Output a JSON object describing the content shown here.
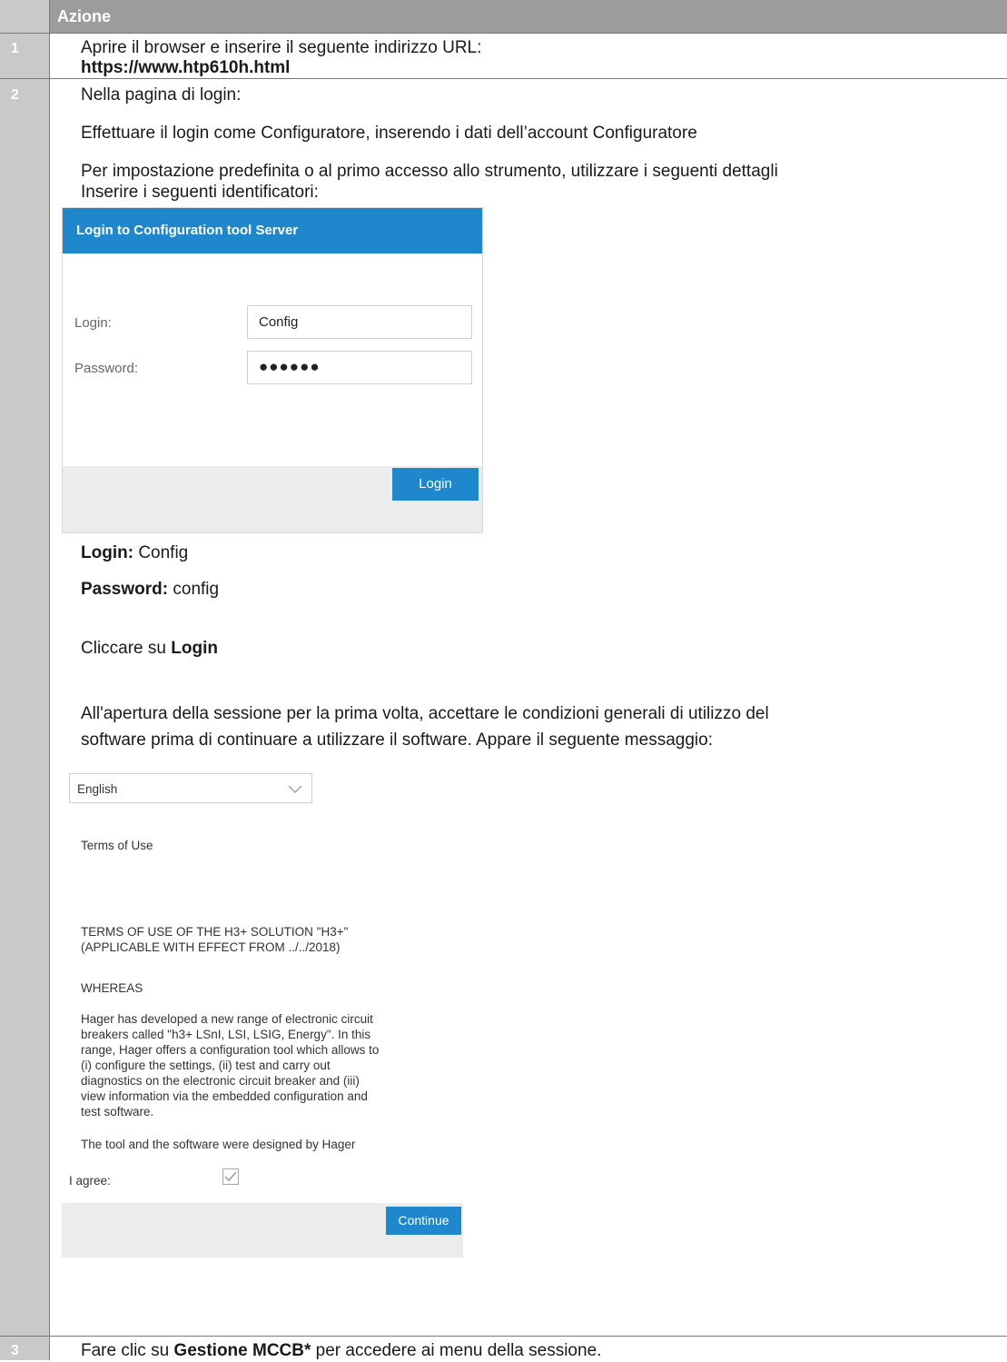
{
  "header": {
    "title": "Azione"
  },
  "steps": [
    {
      "num": "1",
      "line1": "Aprire il browser e inserire il seguente indirizzo URL:",
      "url": "https://www.htp610h.html"
    },
    {
      "num": "2",
      "intro": "Nella pagina di login:",
      "p1": "Effettuare il login come Configuratore, inserendo i dati dell’account Configuratore",
      "p2": "Per impostazione predefinita o al primo accesso allo strumento, utilizzare i seguenti dettagli",
      "p3": "Inserire i seguenti identificatori:",
      "login_label": "Login:",
      "login_value": "Config",
      "password_label": "Password:",
      "password_value": "config",
      "click_prefix": "Cliccare su",
      "click_target": "Login",
      "first_time_line1": "All'apertura della sessione per la prima volta, accettare le condizioni generali di utilizzo del",
      "first_time_line2": "software prima di continuare a utilizzare il software. Appare il seguente messaggio:"
    },
    {
      "num": "3",
      "prefix": "Fare clic su",
      "target": "Gestione MCCB*",
      "suffix": "per accedere ai menu della sessione."
    }
  ],
  "login_screen": {
    "title": "Login to Configuration tool Server",
    "login_label": "Login:",
    "login_value": "Config",
    "password_label": "Password:",
    "password_value": "●●●●●●",
    "button": "Login"
  },
  "terms_screen": {
    "language": "English",
    "heading": "Terms of Use",
    "title_line1": "TERMS OF USE OF THE H3+ SOLUTION \"H3+\"",
    "title_line2": "(APPLICABLE WITH EFFECT FROM ../../2018)",
    "whereas": "WHEREAS",
    "para_lines": [
      "Hager has developed a new range of electronic circuit",
      "breakers called \"h3+ LSnI, LSI, LSIG, Energy\". In this",
      "range, Hager offers a configuration tool which allows to",
      "(i) configure the settings, (ii) test and carry out",
      "diagnostics on the electronic circuit breaker and (iii)",
      "view information via the embedded configuration and",
      "test software."
    ],
    "designed": "The tool and the software were designed by Hager",
    "agree_label": "I agree:",
    "continue_button": "Continue"
  }
}
